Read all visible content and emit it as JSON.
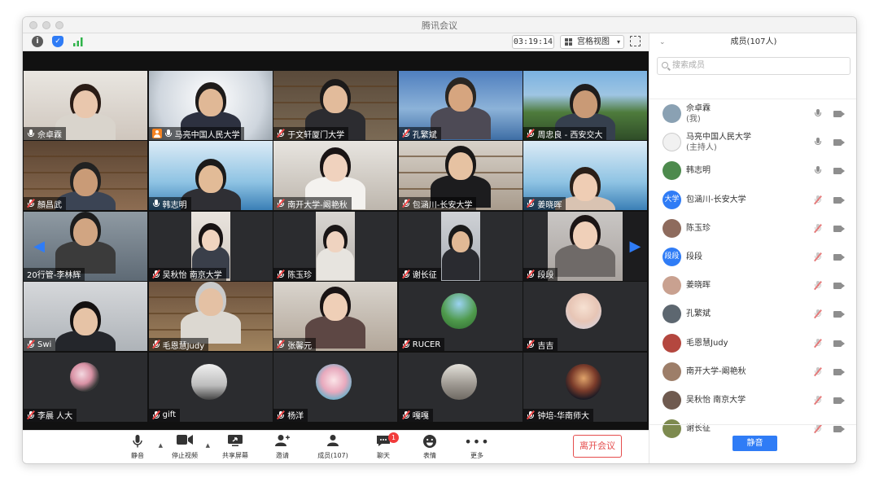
{
  "window": {
    "title": "腾讯会议"
  },
  "toolbar": {
    "timer": "03:19:14",
    "view_label": "宫格视图"
  },
  "grid": {
    "rows": [
      [
        {
          "name": "佘卓霖",
          "mic": "on",
          "host": false
        },
        {
          "name": "马亮中国人民大学",
          "mic": "on",
          "host": true
        },
        {
          "name": "于文轩厦门大学",
          "mic": "muted",
          "host": false
        },
        {
          "name": "孔繁斌",
          "mic": "muted",
          "host": false
        },
        {
          "name": "周忠良 - 西安交大",
          "mic": "muted",
          "host": false
        }
      ],
      [
        {
          "name": "顏昌武",
          "mic": "muted",
          "host": false
        },
        {
          "name": "韩志明",
          "mic": "on",
          "host": false
        },
        {
          "name": "南开大学-阚艳秋",
          "mic": "muted",
          "host": false
        },
        {
          "name": "包涵川-长安大学",
          "mic": "muted",
          "host": false
        },
        {
          "name": "姜晓晖",
          "mic": "muted",
          "host": false
        }
      ],
      [
        {
          "name": "20行管-李林辉",
          "mic": "none",
          "host": false
        },
        {
          "name": "吴秋怡 南京大学",
          "mic": "muted",
          "host": false
        },
        {
          "name": "陈玉珍",
          "mic": "muted",
          "host": false
        },
        {
          "name": "谢长征",
          "mic": "muted",
          "host": false
        },
        {
          "name": "段段",
          "mic": "muted",
          "host": false
        }
      ],
      [
        {
          "name": "Swi",
          "mic": "muted",
          "host": false
        },
        {
          "name": "毛恩慧Judy",
          "mic": "muted",
          "host": false
        },
        {
          "name": "张馨元",
          "mic": "muted",
          "host": false
        },
        {
          "name": "RUCER",
          "mic": "muted",
          "host": false
        },
        {
          "name": "吉吉",
          "mic": "muted",
          "host": false
        }
      ],
      [
        {
          "name": "李晨 人大",
          "mic": "muted",
          "host": false
        },
        {
          "name": "gift",
          "mic": "muted",
          "host": false
        },
        {
          "name": "杨洋",
          "mic": "muted",
          "host": false
        },
        {
          "name": "嘎嘎",
          "mic": "muted",
          "host": false
        },
        {
          "name": "钟培-华南师大",
          "mic": "muted",
          "host": false
        }
      ]
    ]
  },
  "controls": {
    "mute": "静音",
    "stop_video": "停止视频",
    "share_screen": "共享屏幕",
    "invite": "邀请",
    "members": "成员(107)",
    "chat": "聊天",
    "chat_badge": "1",
    "reactions": "表情",
    "more": "更多",
    "leave": "离开会议"
  },
  "panel": {
    "title": "成员(107人)",
    "search_placeholder": "搜索成员",
    "mute_all": "静音",
    "members": [
      {
        "name": "佘卓霖",
        "sub": "(我)",
        "mic": "on",
        "avatar_text": "",
        "color": "#8aa1b3"
      },
      {
        "name": "马亮中国人民大学",
        "sub": "(主持人)",
        "mic": "on",
        "avatar_text": "",
        "color": "#f1f1f1"
      },
      {
        "name": "韩志明",
        "sub": "",
        "mic": "on",
        "avatar_text": "",
        "color": "#4d8a4d"
      },
      {
        "name": "包涵川-长安大学",
        "sub": "",
        "mic": "muted",
        "avatar_text": "大学",
        "color": "#2f7cf6"
      },
      {
        "name": "陈玉珍",
        "sub": "",
        "mic": "muted",
        "avatar_text": "",
        "color": "#8e6b5d"
      },
      {
        "name": "段段",
        "sub": "",
        "mic": "muted",
        "avatar_text": "段段",
        "color": "#2f7cf6"
      },
      {
        "name": "姜晓晖",
        "sub": "",
        "mic": "muted",
        "avatar_text": "",
        "color": "#c9a190"
      },
      {
        "name": "孔繁斌",
        "sub": "",
        "mic": "muted",
        "avatar_text": "",
        "color": "#5d6770"
      },
      {
        "name": "毛恩慧Judy",
        "sub": "",
        "mic": "muted",
        "avatar_text": "",
        "color": "#b4473f"
      },
      {
        "name": "南开大学-阚艳秋",
        "sub": "",
        "mic": "muted",
        "avatar_text": "",
        "color": "#9d7e69"
      },
      {
        "name": "吴秋怡 南京大学",
        "sub": "",
        "mic": "muted",
        "avatar_text": "",
        "color": "#6f5a4f"
      },
      {
        "name": "谢长征",
        "sub": "",
        "mic": "muted",
        "avatar_text": "",
        "color": "#7d8a4f"
      }
    ]
  }
}
